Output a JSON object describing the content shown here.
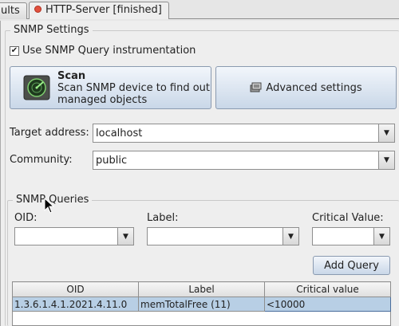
{
  "tabs": [
    {
      "label": "ults"
    },
    {
      "label": "HTTP-Server [finished]"
    }
  ],
  "snmp": {
    "legend": "SNMP Settings",
    "use_instrumentation_label": "Use SNMP Query instrumentation",
    "use_instrumentation_checked": "✔",
    "scan_title": "Scan",
    "scan_desc_line1": "Scan SNMP device to find out",
    "scan_desc_line2": "managed objects",
    "advanced_label": "Advanced settings",
    "target_label": "Target address:",
    "target_value": "localhost",
    "community_label": "Community:",
    "community_value": "public"
  },
  "queries": {
    "legend": "SNMP Queries",
    "oid_label": "OID:",
    "label_label": "Label:",
    "critical_label": "Critical Value:",
    "oid_value": "",
    "label_value": "",
    "critical_value": "",
    "add_button": "Add Query",
    "table": {
      "columns": [
        "OID",
        "Label",
        "Critical value"
      ],
      "rows": [
        [
          "1.3.6.1.4.1.2021.4.11.0",
          "memTotalFree (11)",
          "<10000"
        ]
      ]
    }
  },
  "colors": {
    "selection": "#b8cfe5",
    "button_top": "#f2f6fb",
    "button_bottom": "#c9d7e8",
    "error_dot": "#e2513f"
  }
}
